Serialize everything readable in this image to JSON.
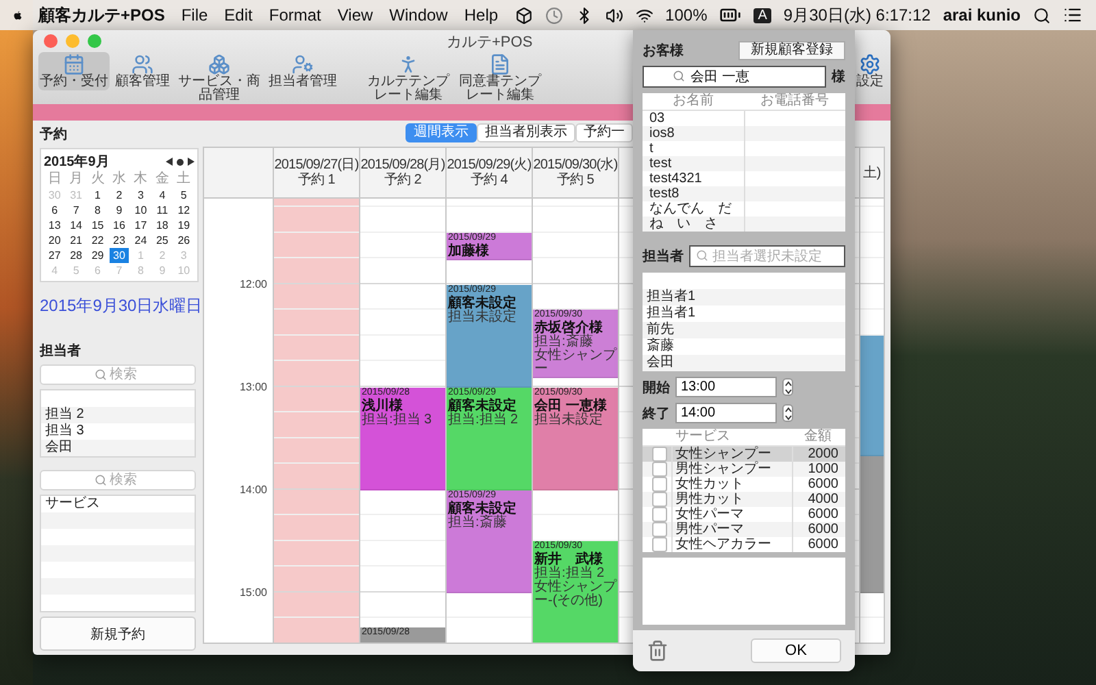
{
  "menu_bar": {
    "app_name": "顧客カルテ+POS",
    "menus": [
      "File",
      "Edit",
      "Format",
      "View",
      "Window",
      "Help"
    ],
    "battery": "100%",
    "input_source": "A",
    "clock": "9月30日(水) 6:17:12",
    "user": "arai kunio"
  },
  "window": {
    "title": "カルテ+POS"
  },
  "toolbar": {
    "items": [
      {
        "label": "予約・受付",
        "selected": true
      },
      {
        "label": "顧客管理",
        "selected": false
      },
      {
        "label": "サービス・商品管理",
        "selected": false
      },
      {
        "label": "担当者管理",
        "selected": false
      },
      {
        "label": "カルテテンプレート編集",
        "selected": false
      },
      {
        "label": "同意書テンプレート編集",
        "selected": false
      }
    ],
    "settings": "設定"
  },
  "sidebar": {
    "title": "予約",
    "mini_calendar": {
      "month": "2015年9月",
      "weekdays": [
        "日",
        "月",
        "火",
        "水",
        "木",
        "金",
        "土"
      ],
      "weeks": [
        [
          {
            "day": "30",
            "in_month": false,
            "selected": false
          },
          {
            "day": "31",
            "in_month": false,
            "selected": false
          },
          {
            "day": "1",
            "in_month": true,
            "selected": false
          },
          {
            "day": "2",
            "in_month": true,
            "selected": false
          },
          {
            "day": "3",
            "in_month": true,
            "selected": false
          },
          {
            "day": "4",
            "in_month": true,
            "selected": false
          },
          {
            "day": "5",
            "in_month": true,
            "selected": false
          }
        ],
        [
          {
            "day": "6",
            "in_month": true,
            "selected": false
          },
          {
            "day": "7",
            "in_month": true,
            "selected": false
          },
          {
            "day": "8",
            "in_month": true,
            "selected": false
          },
          {
            "day": "9",
            "in_month": true,
            "selected": false
          },
          {
            "day": "10",
            "in_month": true,
            "selected": false
          },
          {
            "day": "11",
            "in_month": true,
            "selected": false
          },
          {
            "day": "12",
            "in_month": true,
            "selected": false
          }
        ],
        [
          {
            "day": "13",
            "in_month": true,
            "selected": false
          },
          {
            "day": "14",
            "in_month": true,
            "selected": false
          },
          {
            "day": "15",
            "in_month": true,
            "selected": false
          },
          {
            "day": "16",
            "in_month": true,
            "selected": false
          },
          {
            "day": "17",
            "in_month": true,
            "selected": false
          },
          {
            "day": "18",
            "in_month": true,
            "selected": false
          },
          {
            "day": "19",
            "in_month": true,
            "selected": false
          }
        ],
        [
          {
            "day": "20",
            "in_month": true,
            "selected": false
          },
          {
            "day": "21",
            "in_month": true,
            "selected": false
          },
          {
            "day": "22",
            "in_month": true,
            "selected": false
          },
          {
            "day": "23",
            "in_month": true,
            "selected": false
          },
          {
            "day": "24",
            "in_month": true,
            "selected": false
          },
          {
            "day": "25",
            "in_month": true,
            "selected": false
          },
          {
            "day": "26",
            "in_month": true,
            "selected": false
          }
        ],
        [
          {
            "day": "27",
            "in_month": true,
            "selected": false
          },
          {
            "day": "28",
            "in_month": true,
            "selected": false
          },
          {
            "day": "29",
            "in_month": true,
            "selected": false
          },
          {
            "day": "30",
            "in_month": true,
            "selected": true
          },
          {
            "day": "1",
            "in_month": false,
            "selected": false
          },
          {
            "day": "2",
            "in_month": false,
            "selected": false
          },
          {
            "day": "3",
            "in_month": false,
            "selected": false
          }
        ],
        [
          {
            "day": "4",
            "in_month": false,
            "selected": false
          },
          {
            "day": "5",
            "in_month": false,
            "selected": false
          },
          {
            "day": "6",
            "in_month": false,
            "selected": false
          },
          {
            "day": "7",
            "in_month": false,
            "selected": false
          },
          {
            "day": "8",
            "in_month": false,
            "selected": false
          },
          {
            "day": "9",
            "in_month": false,
            "selected": false
          },
          {
            "day": "10",
            "in_month": false,
            "selected": false
          }
        ]
      ]
    },
    "selected_date": "2015年9月30日水曜日",
    "staff": {
      "title": "担当者",
      "search_placeholder": "検索",
      "items": [
        "担当 2",
        "担当 3",
        "会田"
      ]
    },
    "services": {
      "search_placeholder": "検索",
      "items": [
        "サービス"
      ]
    },
    "new_button": "新規予約"
  },
  "view_tabs": [
    {
      "label": "週間表示",
      "selected": true
    },
    {
      "label": "担当者別表示",
      "selected": false
    },
    {
      "label": "予約一",
      "selected": false
    }
  ],
  "schedule": {
    "times": [
      "12:00",
      "13:00",
      "14:00",
      "15:00"
    ],
    "days": [
      {
        "date": "2015/09/27(日)",
        "count": "予約 1",
        "closed": true
      },
      {
        "date": "2015/09/28(月)",
        "count": "予約 2",
        "closed": false,
        "events": [
          {
            "color": "#d452d8",
            "date": "2015/09/28",
            "name": "浅川様",
            "lines": [
              "担当:担当 3"
            ]
          },
          {
            "color": "#9a9a9a",
            "date": "2015/09/28"
          }
        ]
      },
      {
        "date": "2015/09/29(火)",
        "count": "予約 4",
        "closed": false,
        "events": [
          {
            "color": "#cc7ad8",
            "date": "2015/09/29",
            "name": "加藤様"
          },
          {
            "color": "#67a3c8",
            "date": "2015/09/29",
            "name": "顧客未設定",
            "lines": [
              "担当未設定"
            ]
          },
          {
            "color": "#55d866",
            "date": "2015/09/29",
            "name": "顧客未設定",
            "lines": [
              "担当:担当 2"
            ]
          },
          {
            "color": "#cc7ad8",
            "date": "2015/09/29",
            "name": "顧客未設定",
            "lines": [
              "担当:斎藤"
            ]
          }
        ]
      },
      {
        "date": "2015/09/30(水)",
        "count": "予約 5",
        "closed": false,
        "events": [
          {
            "color": "#cc7fd6",
            "date": "2015/09/30",
            "name": "赤坂啓介様",
            "lines": [
              "担当:斎藤",
              "女性シャンプー"
            ]
          },
          {
            "color": "#e07fa8",
            "date": "2015/09/30",
            "name": "会田 一恵様",
            "lines": [
              "担当未設定"
            ]
          },
          {
            "color": "#55d866",
            "date": "2015/09/30",
            "name": "新井　武様",
            "lines": [
              "担当:担当 2",
              "女性シャンプー-(その他)"
            ]
          }
        ]
      }
    ],
    "last_day": {
      "date": "土)",
      "events": [
        {
          "color": "#67a3c8"
        },
        {
          "color": "#9a9a9a"
        }
      ]
    }
  },
  "popover": {
    "customer": {
      "label": "お客様",
      "new_button": "新規顧客登録",
      "search_value": "会田 一恵",
      "suffix": "様",
      "columns": [
        "お名前",
        "お電話番号"
      ],
      "rows": [
        "03",
        "ios8",
        "t",
        "test",
        "test4321",
        "test8",
        "なんでん　だ",
        "ね　い　さ"
      ]
    },
    "staff": {
      "label": "担当者",
      "placeholder": "担当者選択未設定",
      "items": [
        "担当者1",
        "担当者1",
        "前先",
        "斎藤",
        "会田"
      ]
    },
    "start": {
      "label": "開始",
      "value": "13:00"
    },
    "end": {
      "label": "終了",
      "value": "14:00"
    },
    "services": {
      "columns": [
        "サービス",
        "金額"
      ],
      "rows": [
        {
          "name": "女性シャンプー",
          "price": "2000",
          "checked": false,
          "selected": true
        },
        {
          "name": "男性シャンプー",
          "price": "1000",
          "checked": false,
          "selected": false
        },
        {
          "name": "女性カット",
          "price": "6000",
          "checked": false,
          "selected": false
        },
        {
          "name": "男性カット",
          "price": "4000",
          "checked": false,
          "selected": false
        },
        {
          "name": "女性パーマ",
          "price": "6000",
          "checked": false,
          "selected": false
        },
        {
          "name": "男性パーマ",
          "price": "6000",
          "checked": false,
          "selected": false
        },
        {
          "name": "女性ヘアカラー",
          "price": "6000",
          "checked": false,
          "selected": false
        }
      ]
    },
    "ok": "OK"
  }
}
